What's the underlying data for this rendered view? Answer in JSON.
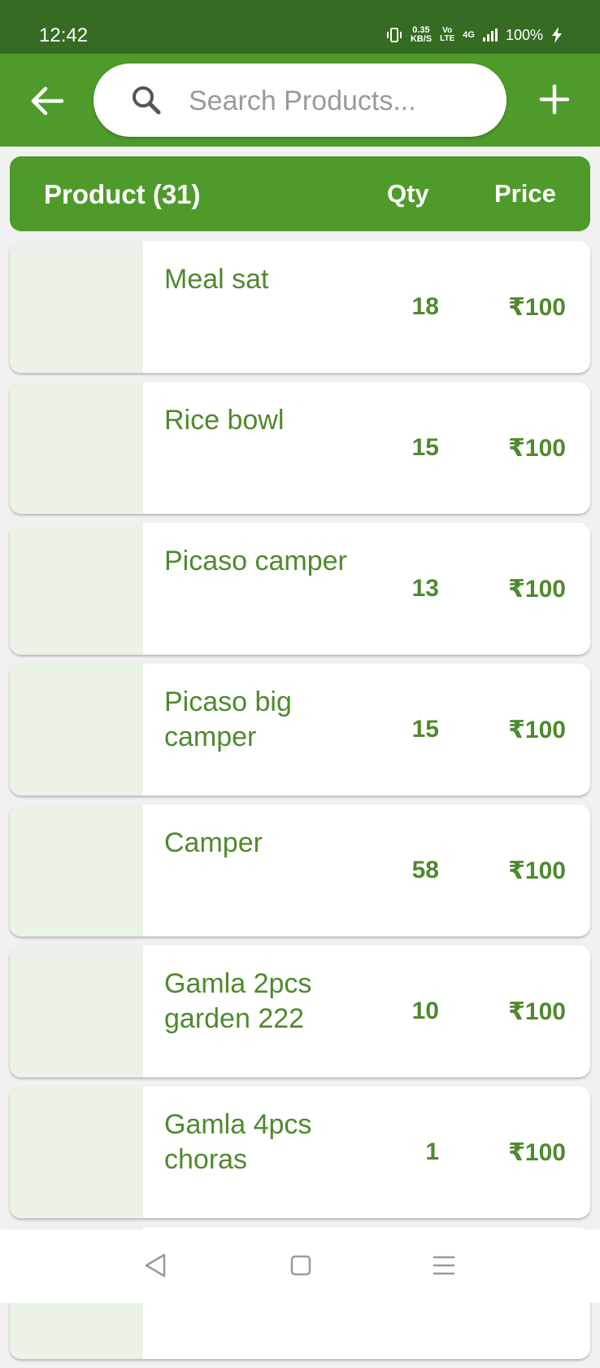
{
  "status_bar": {
    "time": "12:42",
    "net_speed_value": "0.35",
    "net_speed_unit": "KB/S",
    "volte_top": "Vo",
    "volte_bottom": "LTE",
    "network_type": "4G",
    "battery": "100%"
  },
  "app_bar": {
    "search_placeholder": "Search Products...",
    "search_value": ""
  },
  "list_header": {
    "product_label": "Product (31)",
    "qty_label": "Qty",
    "price_label": "Price"
  },
  "products": [
    {
      "name": "Meal sat",
      "qty": "18",
      "price": "₹100"
    },
    {
      "name": "Rice bowl",
      "qty": "15",
      "price": "₹100"
    },
    {
      "name": "Picaso camper",
      "qty": "13",
      "price": "₹100"
    },
    {
      "name": "Picaso big camper",
      "qty": "15",
      "price": "₹100"
    },
    {
      "name": "Camper",
      "qty": "58",
      "price": "₹100"
    },
    {
      "name": "Gamla 2pcs garden 222",
      "qty": "10",
      "price": "₹100"
    },
    {
      "name": "Gamla 4pcs choras",
      "qty": "1",
      "price": "₹100"
    }
  ],
  "colors": {
    "status_bar": "#356b22",
    "app_bar": "#4e9b2b",
    "accent_text": "#4e8a2d",
    "thumb_bg": "#ebf3e8"
  },
  "icons": {
    "back": "arrow-left-icon",
    "search": "search-icon",
    "add": "plus-icon",
    "nav_back": "triangle-back-icon",
    "nav_home": "square-home-icon",
    "nav_menu": "menu-lines-icon"
  }
}
